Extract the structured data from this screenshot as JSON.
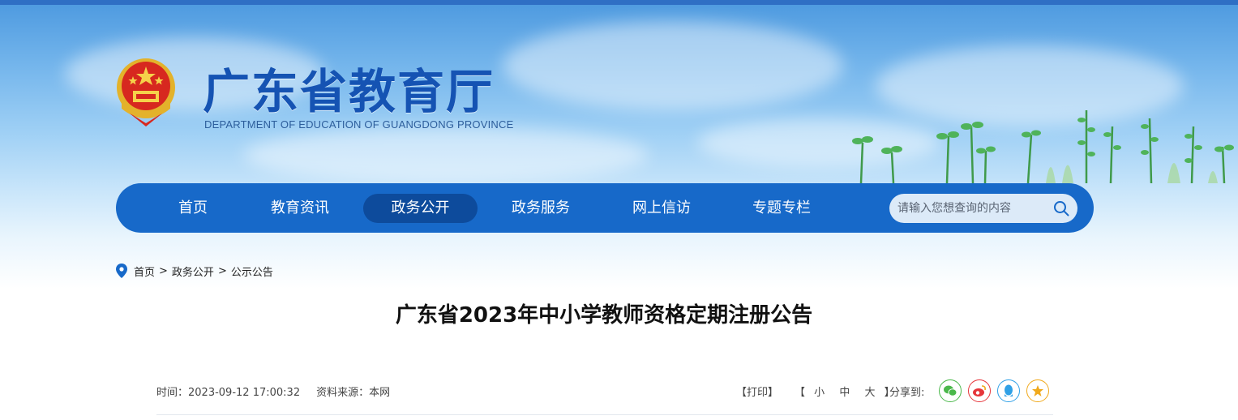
{
  "header": {
    "title": "广东省教育厅",
    "subtitle": "DEPARTMENT OF EDUCATION OF GUANGDONG PROVINCE",
    "emblem_icon": "national-emblem-icon"
  },
  "nav": {
    "items": [
      {
        "label": "首页",
        "active": false
      },
      {
        "label": "教育资讯",
        "active": false
      },
      {
        "label": "政务公开",
        "active": true
      },
      {
        "label": "政务服务",
        "active": false
      },
      {
        "label": "网上信访",
        "active": false
      },
      {
        "label": "专题专栏",
        "active": false
      }
    ],
    "search": {
      "placeholder": "请输入您想查询的内容",
      "icon": "search-icon"
    }
  },
  "breadcrumb": {
    "icon": "location-pin-icon",
    "items": [
      "首页",
      "政务公开",
      "公示公告"
    ],
    "separator": ">"
  },
  "article": {
    "title": "广东省2023年中小学教师资格定期注册公告",
    "time_label": "时间：",
    "time": "2023-09-12 17:00:32",
    "source_label": "资料来源：",
    "source": "本网"
  },
  "tools": {
    "print": "【打印】",
    "size_open": "【",
    "size_small": "小",
    "size_medium": "中",
    "size_large": "大",
    "size_close": "】",
    "share_label": "分享到:",
    "share_icons": [
      "wechat-icon",
      "weibo-icon",
      "qq-icon",
      "qzone-icon"
    ]
  },
  "colors": {
    "nav_bg": "#1769c9",
    "nav_active": "#0d4b9c",
    "title_blue": "#1553b3",
    "wechat": "#4bb84b",
    "weibo": "#e6353a",
    "qq": "#2fa0e6",
    "qzone": "#f0a91c"
  }
}
